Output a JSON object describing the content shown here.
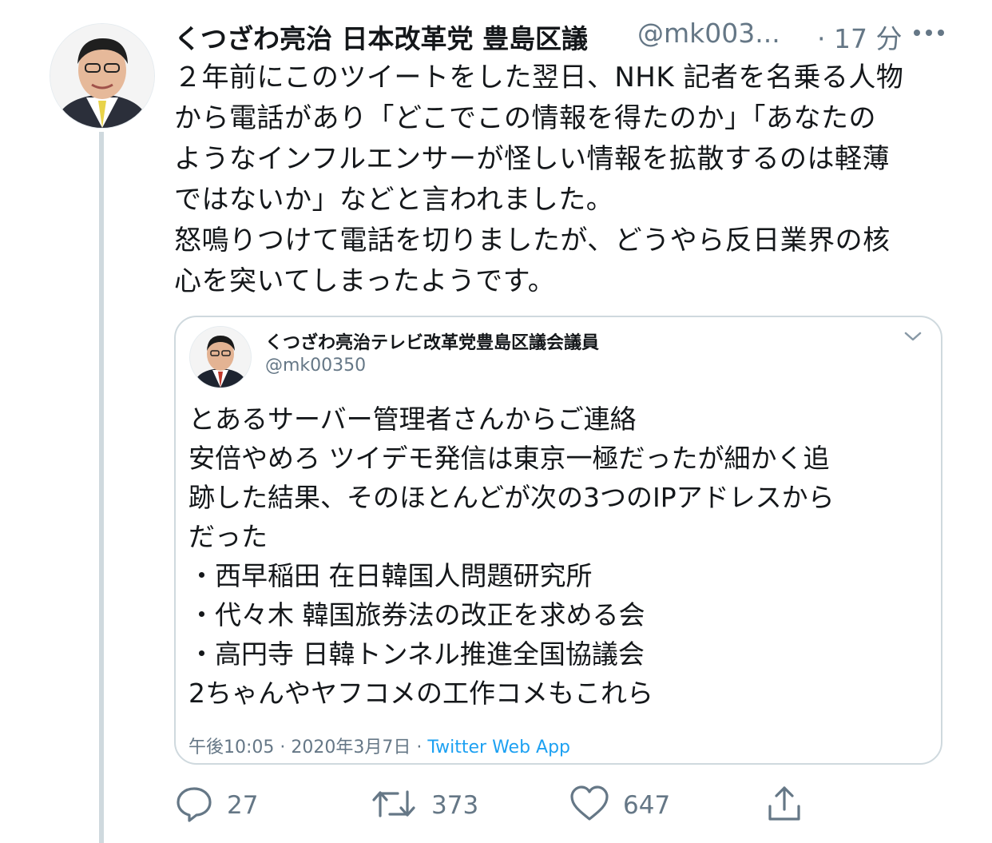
{
  "tweet": {
    "author_name": "くつざわ亮治 日本改革党 豊島区議",
    "author_handle": "@mk003...",
    "time": "· 17 分",
    "text_lines": [
      "２年前にこのツイートをした翌日、NHK 記者を名乗る人物",
      "から電話があり「どこでこの情報を得たのか」「あなたの",
      "ようなインフルエンサーが怪しい情報を拡散するのは軽薄",
      "ではないか」などと言われました。",
      "怒鳴りつけて電話を切りましたが、どうやら反日業界の核",
      "心を突いてしまったようです。"
    ]
  },
  "quoted_tweet": {
    "author_name": "くつざわ亮治テレビ改革党豊島区議会議員",
    "author_handle": "@mk00350",
    "text_lines": [
      "とあるサーバー管理者さんからご連絡",
      "安倍やめろ ツイデモ発信は東京一極だったが細かく追",
      "跡した結果、そのほとんどが次の3つのIPアドレスから",
      "だった",
      "・西早稲田 在日韓国人問題研究所",
      "・代々木 韓国旅券法の改正を求める会",
      "・高円寺 日韓トンネル推進全国協議会",
      "2ちゃんやヤフコメの工作コメもこれら"
    ],
    "timestamp": "午後10:05 · 2020年3月7日 · ",
    "source": "Twitter Web App"
  },
  "actions": {
    "reply_count": "27",
    "retweet_count": "373",
    "like_count": "647"
  },
  "colors": {
    "text": "#14171a",
    "secondary": "#657786",
    "link": "#1da1f2",
    "border": "#cfd9de"
  },
  "icons": [
    "more-icon",
    "chevron-down-icon",
    "reply-icon",
    "retweet-icon",
    "like-icon",
    "share-icon"
  ]
}
